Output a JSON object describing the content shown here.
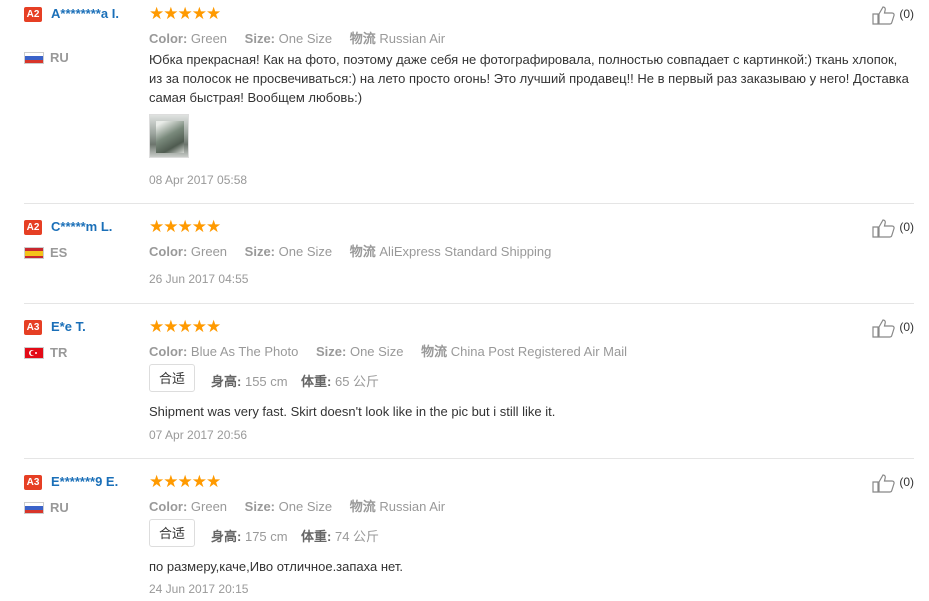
{
  "labels": {
    "color": "Color:",
    "size": "Size:",
    "logistics": "物流",
    "height": "身高:",
    "weight": "体重:"
  },
  "colors": {
    "star": "#ff9a00",
    "badge": "#e63f24",
    "username": "#1a6fb8"
  },
  "reviews": [
    {
      "badge": "A2",
      "name": "A********a I.",
      "country": "RU",
      "flag": "russia-flag",
      "stars": "★★★★★",
      "rating": 5,
      "color": "Green",
      "size": "One Size",
      "shipping": "Russian Air",
      "text": "Юбка прекрасная! Как на фото, поэтому даже себя не фотографировала, полностью совпадает с картинкой:) ткань хлопок, из за полосок не просвечиваться:) на лето просто огонь! Это лучший продавец!! Не в первый раз заказываю у него! Доставка самая быстрая! Вообщем любовь:)",
      "date": "08 Apr 2017 05:58",
      "likes": "(0)"
    },
    {
      "badge": "A2",
      "name": "C*****m L.",
      "country": "ES",
      "flag": "spain-flag",
      "stars": "★★★★★",
      "rating": 5,
      "color": "Green",
      "size": "One Size",
      "shipping": "AliExpress Standard Shipping",
      "date": "26 Jun 2017 04:55",
      "likes": "(0)"
    },
    {
      "badge": "A3",
      "name": "E*e T.",
      "country": "TR",
      "flag": "turkey-flag",
      "stars": "★★★★★",
      "rating": 5,
      "color": "Blue As The Photo",
      "size": "One Size",
      "shipping": "China Post Registered Air Mail",
      "fit": "合适",
      "height": "155 cm",
      "weight": "65 公斤",
      "text": "Shipment was very fast. Skirt doesn't look like in the pic but i still like it.",
      "date": "07 Apr 2017 20:56",
      "likes": "(0)"
    },
    {
      "badge": "A3",
      "name": "E*******9 E.",
      "country": "RU",
      "flag": "russia-flag",
      "stars": "★★★★★",
      "rating": 5,
      "color": "Green",
      "size": "One Size",
      "shipping": "Russian Air",
      "fit": "合适",
      "height": "175 cm",
      "weight": "74 公斤",
      "text": "по размеру,каче,Иво отличное.запаха нет.",
      "date": "24 Jun 2017 20:15",
      "likes": "(0)"
    }
  ]
}
